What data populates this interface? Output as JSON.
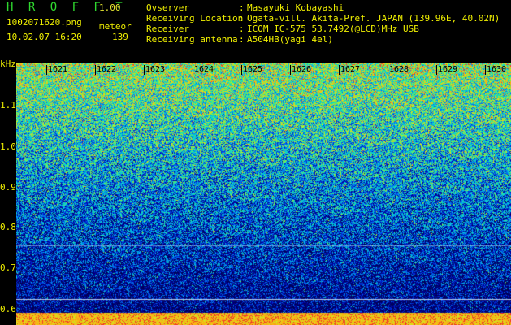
{
  "header": {
    "app_title": "H R O F F T",
    "app_version": "1.00",
    "file_name": "1002071620.png",
    "timestamp": "10.02.07 16:20",
    "mode_label": "meteor",
    "count_value": "139"
  },
  "info": [
    {
      "key": "Ovserver",
      "value": "Masayuki Kobayashi"
    },
    {
      "key": "Receiving Location",
      "value": "Ogata-vill. Akita-Pref. JAPAN (139.96E, 40.02N)"
    },
    {
      "key": "Receiver",
      "value": "ICOM IC-575 53.7492(@LCD)MHz USB"
    },
    {
      "key": "Receiving antenna",
      "value": "A504HB(yagi 4el)"
    }
  ],
  "axis": {
    "unit": "kHz",
    "y_labels": [
      "1.1",
      "1.0",
      "0.9",
      "0.8",
      "0.7",
      "0.6"
    ],
    "time_ticks": [
      "1621",
      "1622",
      "1623",
      "1624",
      "1625",
      "1626",
      "1627",
      "1628",
      "1629",
      "1630"
    ]
  },
  "colors": {
    "label": "#f0f000",
    "title": "#2fd82f"
  }
}
